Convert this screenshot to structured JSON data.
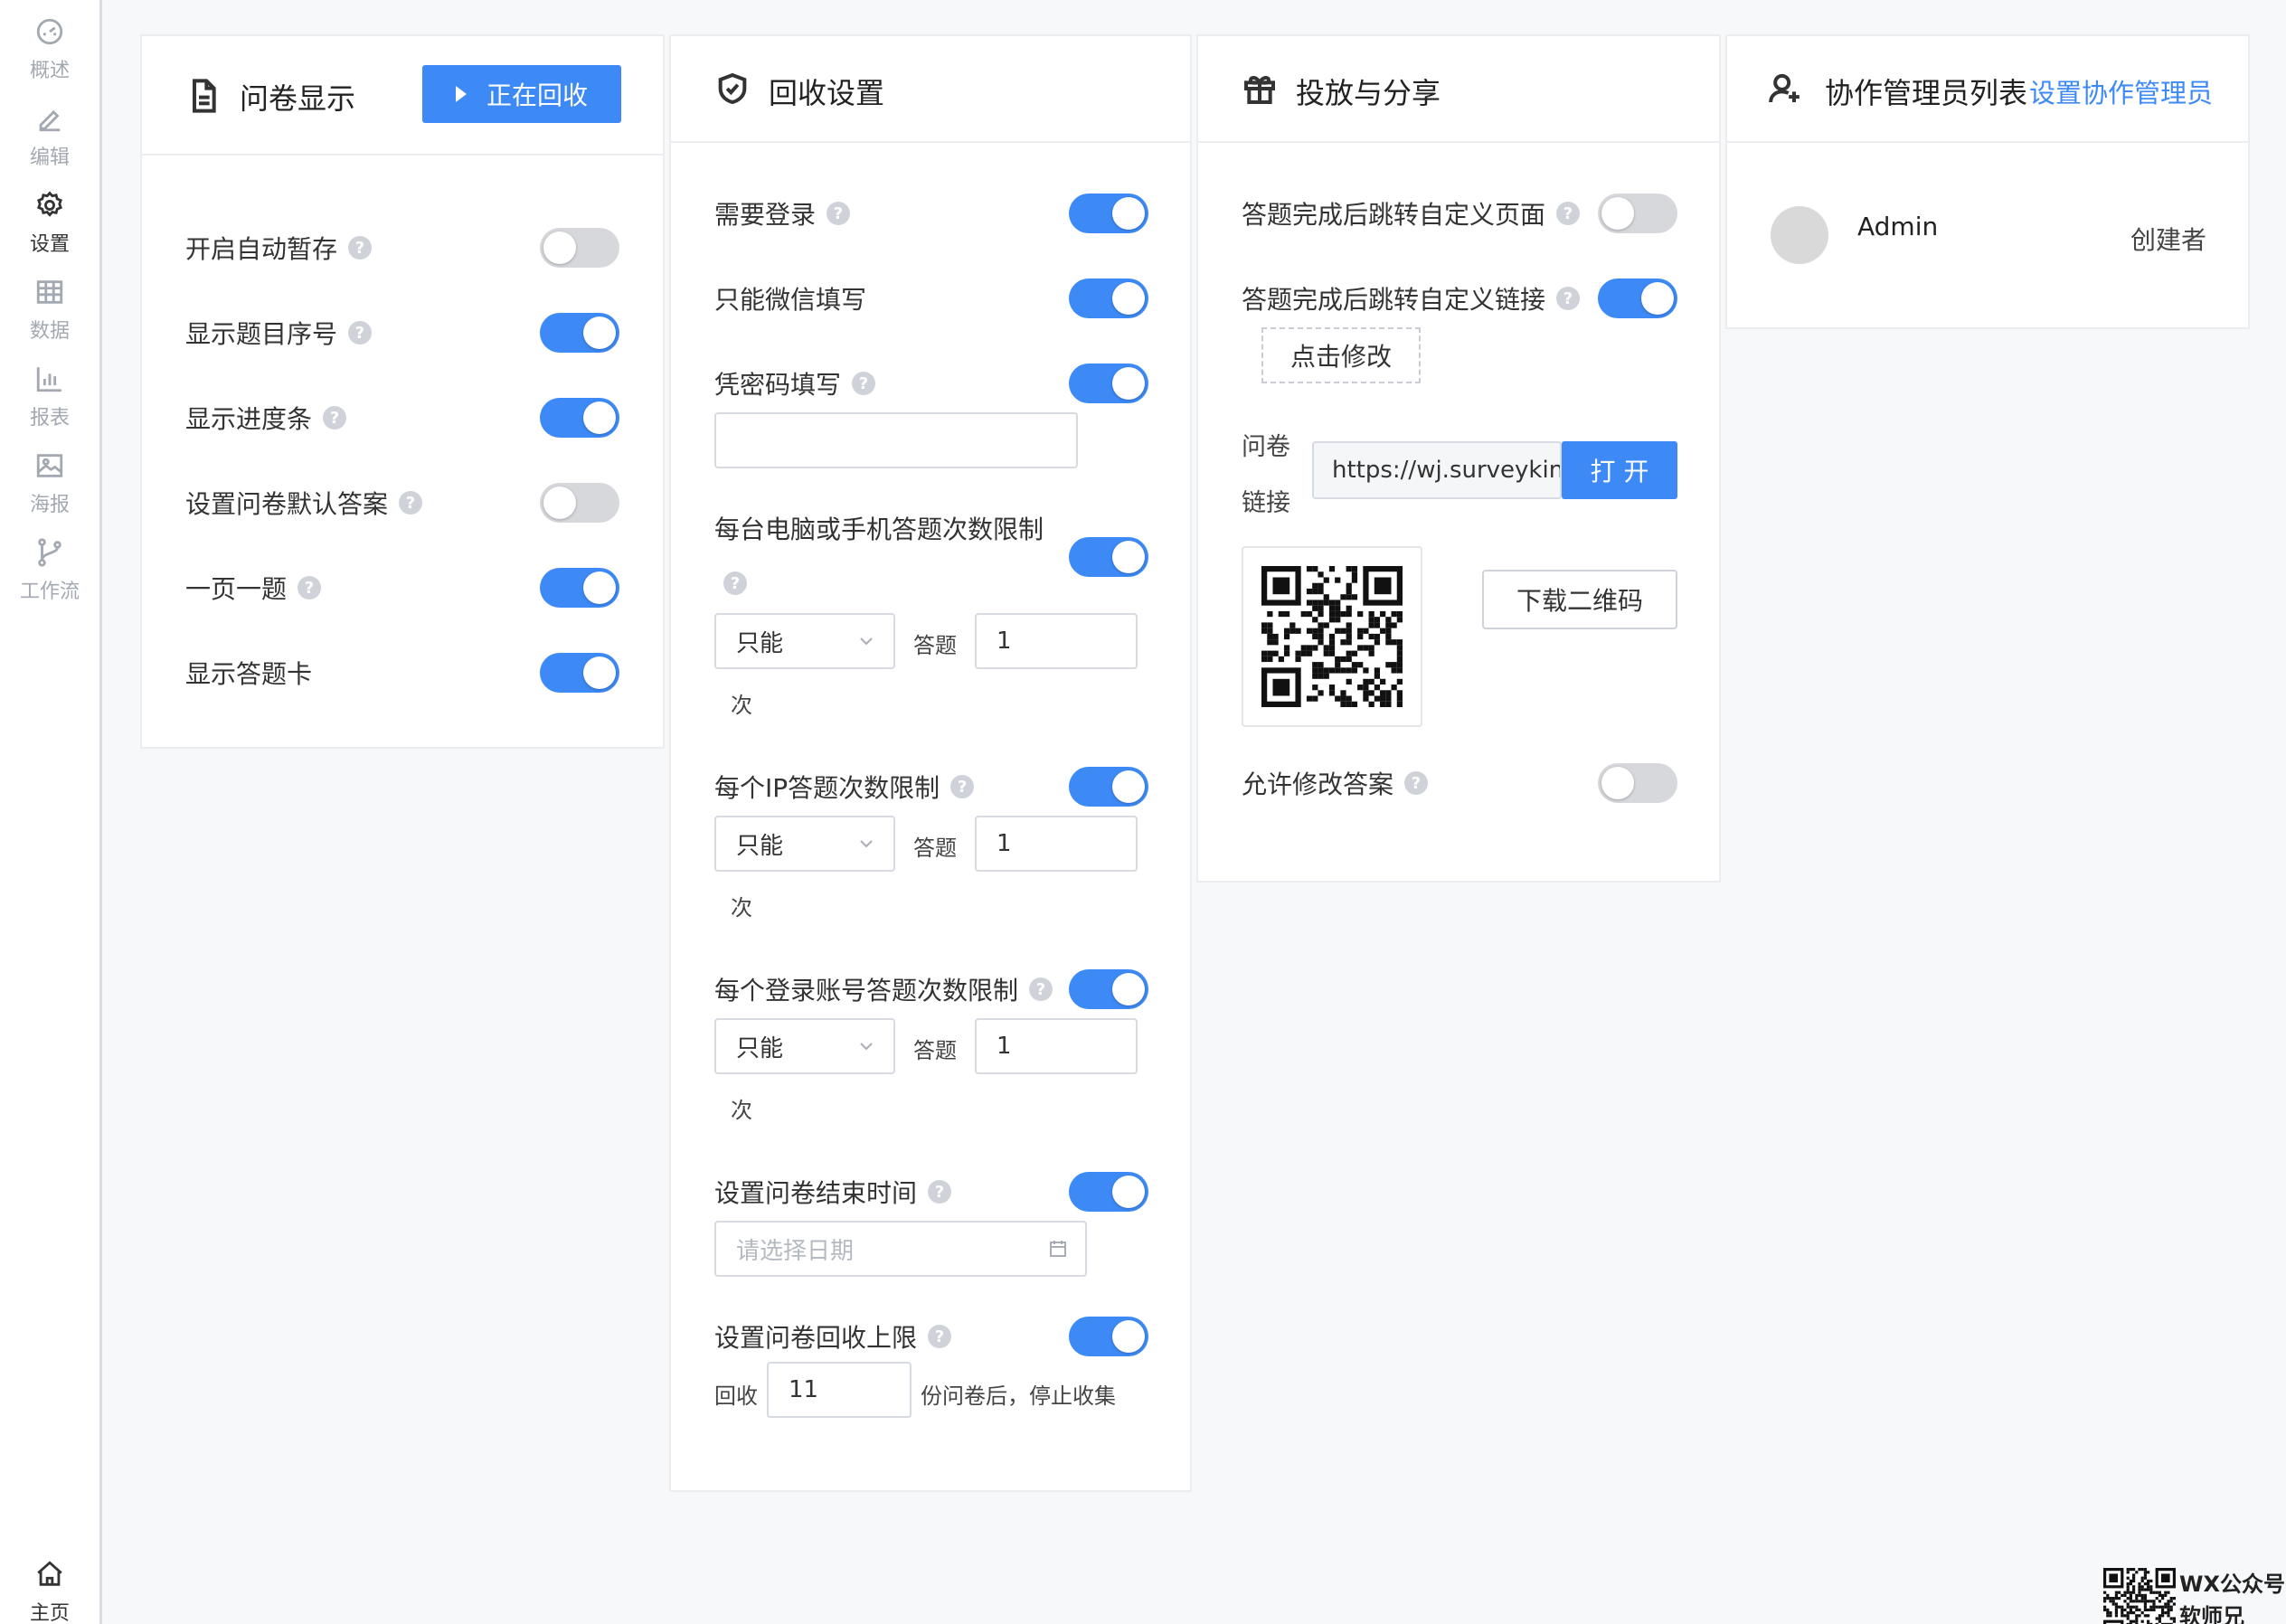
{
  "sidebar": {
    "items": [
      {
        "label": "概述",
        "icon": "dashboard-icon"
      },
      {
        "label": "编辑",
        "icon": "pencil-icon"
      },
      {
        "label": "设置",
        "icon": "gear-icon"
      },
      {
        "label": "数据",
        "icon": "table-icon"
      },
      {
        "label": "报表",
        "icon": "bar-chart-icon"
      },
      {
        "label": "海报",
        "icon": "image-icon"
      },
      {
        "label": "工作流",
        "icon": "branch-icon"
      }
    ],
    "home_label": "主页"
  },
  "display": {
    "title": "问卷显示",
    "status_button": "正在回收",
    "rows": [
      {
        "label": "开启自动暂存",
        "on": false,
        "help": true
      },
      {
        "label": "显示题目序号",
        "on": true,
        "help": true
      },
      {
        "label": "显示进度条",
        "on": true,
        "help": true
      },
      {
        "label": "设置问卷默认答案",
        "on": false,
        "help": true
      },
      {
        "label": "一页一题",
        "on": true,
        "help": true
      },
      {
        "label": "显示答题卡",
        "on": true,
        "help": false
      }
    ]
  },
  "collection": {
    "title": "回收设置",
    "require_login": "需要登录",
    "wechat_only": "只能微信填写",
    "password_fill": "凭密码填写",
    "password_value": "",
    "device_limit": "每台电脑或手机答题次数限制",
    "ip_limit": "每个IP答题次数限制",
    "account_limit": "每个登录账号答题次数限制",
    "limit_select": "只能",
    "limit_answer_label": "答题",
    "limit_value": "1",
    "times_unit": "次",
    "end_time": "设置问卷结束时间",
    "date_placeholder": "请选择日期",
    "recovery_limit": "设置问卷回收上限",
    "recovery_prefix": "回收",
    "recovery_value": "11",
    "recovery_suffix": "份问卷后，停止收集"
  },
  "share": {
    "title": "投放与分享",
    "redirect_page": "答题完成后跳转自定义页面",
    "redirect_link": "答题完成后跳转自定义链接",
    "edit_button": "点击修改",
    "link_label_1": "问卷",
    "link_label_2": "链接",
    "link_value": "https://wj.surveyking.cn",
    "open_button": "打 开",
    "download_button": "下载二维码",
    "allow_modify": "允许修改答案"
  },
  "admins": {
    "title": "协作管理员列表",
    "set_link": "设置协作管理员",
    "name": "Admin",
    "role": "创建者"
  },
  "watermark": {
    "line1": "WX公众号",
    "line2": "软师兄"
  },
  "colors": {
    "primary": "#3d8af7",
    "toggle_off": "#d6d8dc",
    "border": "#ebedf0"
  }
}
